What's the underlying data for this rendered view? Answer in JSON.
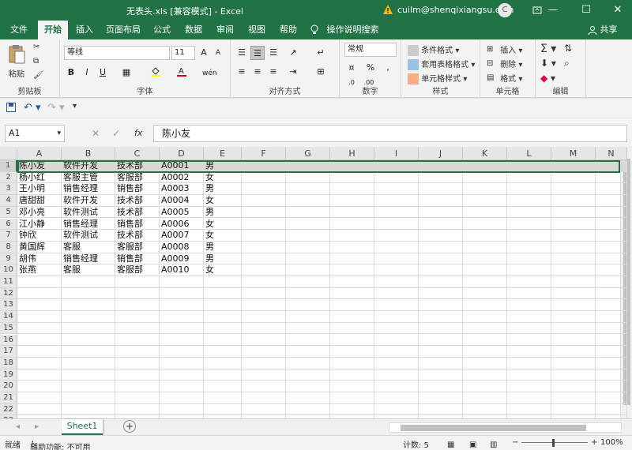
{
  "window": {
    "title": "无表头.xls  [兼容模式]  -  Excel",
    "account": "cuilm@shenqixiangsu.com",
    "avatar_letter": "C",
    "minimize": "—",
    "restore": "☐",
    "close": "✕"
  },
  "tabs": [
    "文件",
    "开始",
    "插入",
    "页面布局",
    "公式",
    "数据",
    "审阅",
    "视图",
    "帮助"
  ],
  "active_tab": "开始",
  "tell_me": "操作说明搜索",
  "share": "共享",
  "ribbon": {
    "clipboard": {
      "paste": "粘贴",
      "label": "剪贴板"
    },
    "font": {
      "name": "等线",
      "size": "11",
      "bold": "B",
      "italic": "I",
      "underline": "U",
      "grow": "A",
      "shrink": "A",
      "label": "字体"
    },
    "alignment": {
      "label": "对齐方式"
    },
    "number": {
      "format": "常规",
      "percent": "%",
      "comma": ",",
      "label": "数字"
    },
    "styles": {
      "conditional": "条件格式",
      "table": "套用表格格式",
      "cell": "单元格样式",
      "label": "样式"
    },
    "cells": {
      "insert": "插入",
      "delete": "删除",
      "format": "格式",
      "label": "单元格"
    },
    "editing": {
      "label": "编辑"
    }
  },
  "qat": {
    "save": "save-icon",
    "undo": "undo-icon",
    "redo": "redo-icon"
  },
  "formula_bar": {
    "name_box": "A1",
    "formula": "陈小友",
    "fx": "fx"
  },
  "columns": [
    "A",
    "B",
    "C",
    "D",
    "E",
    "F",
    "G",
    "H",
    "I",
    "J",
    "K",
    "L",
    "M",
    "N"
  ],
  "rows": [
    [
      "陈小友",
      "软件开发",
      "技术部",
      "A0001",
      "男"
    ],
    [
      "杨小红",
      "客服主管",
      "客服部",
      "A0002",
      "女"
    ],
    [
      "王小明",
      "销售经理",
      "销售部",
      "A0003",
      "男"
    ],
    [
      "唐甜甜",
      "软件开发",
      "技术部",
      "A0004",
      "女"
    ],
    [
      "邓小亮",
      "软件测试",
      "技术部",
      "A0005",
      "男"
    ],
    [
      "江小静",
      "销售经理",
      "销售部",
      "A0006",
      "女"
    ],
    [
      "钟欣",
      "软件测试",
      "技术部",
      "A0007",
      "女"
    ],
    [
      "黄国辉",
      "客服",
      "客服部",
      "A0008",
      "男"
    ],
    [
      "胡伟",
      "销售经理",
      "销售部",
      "A0009",
      "男"
    ],
    [
      "张燕",
      "客服",
      "客服部",
      "A0010",
      "女"
    ]
  ],
  "row_numbers": [
    "1",
    "2",
    "3",
    "4",
    "5",
    "6",
    "7",
    "8",
    "9",
    "10",
    "11",
    "12",
    "13",
    "14",
    "15",
    "16",
    "17",
    "18",
    "19",
    "20",
    "21",
    "22",
    "23"
  ],
  "sheet": {
    "name": "Sheet1",
    "add": "+"
  },
  "status": {
    "ready": "就绪",
    "accessibility": "辅助功能: 不可用",
    "count": "计数: 5",
    "zoom": "100%",
    "zoom_minus": "−",
    "zoom_plus": "+"
  },
  "colors": {
    "accent": "#217346"
  }
}
